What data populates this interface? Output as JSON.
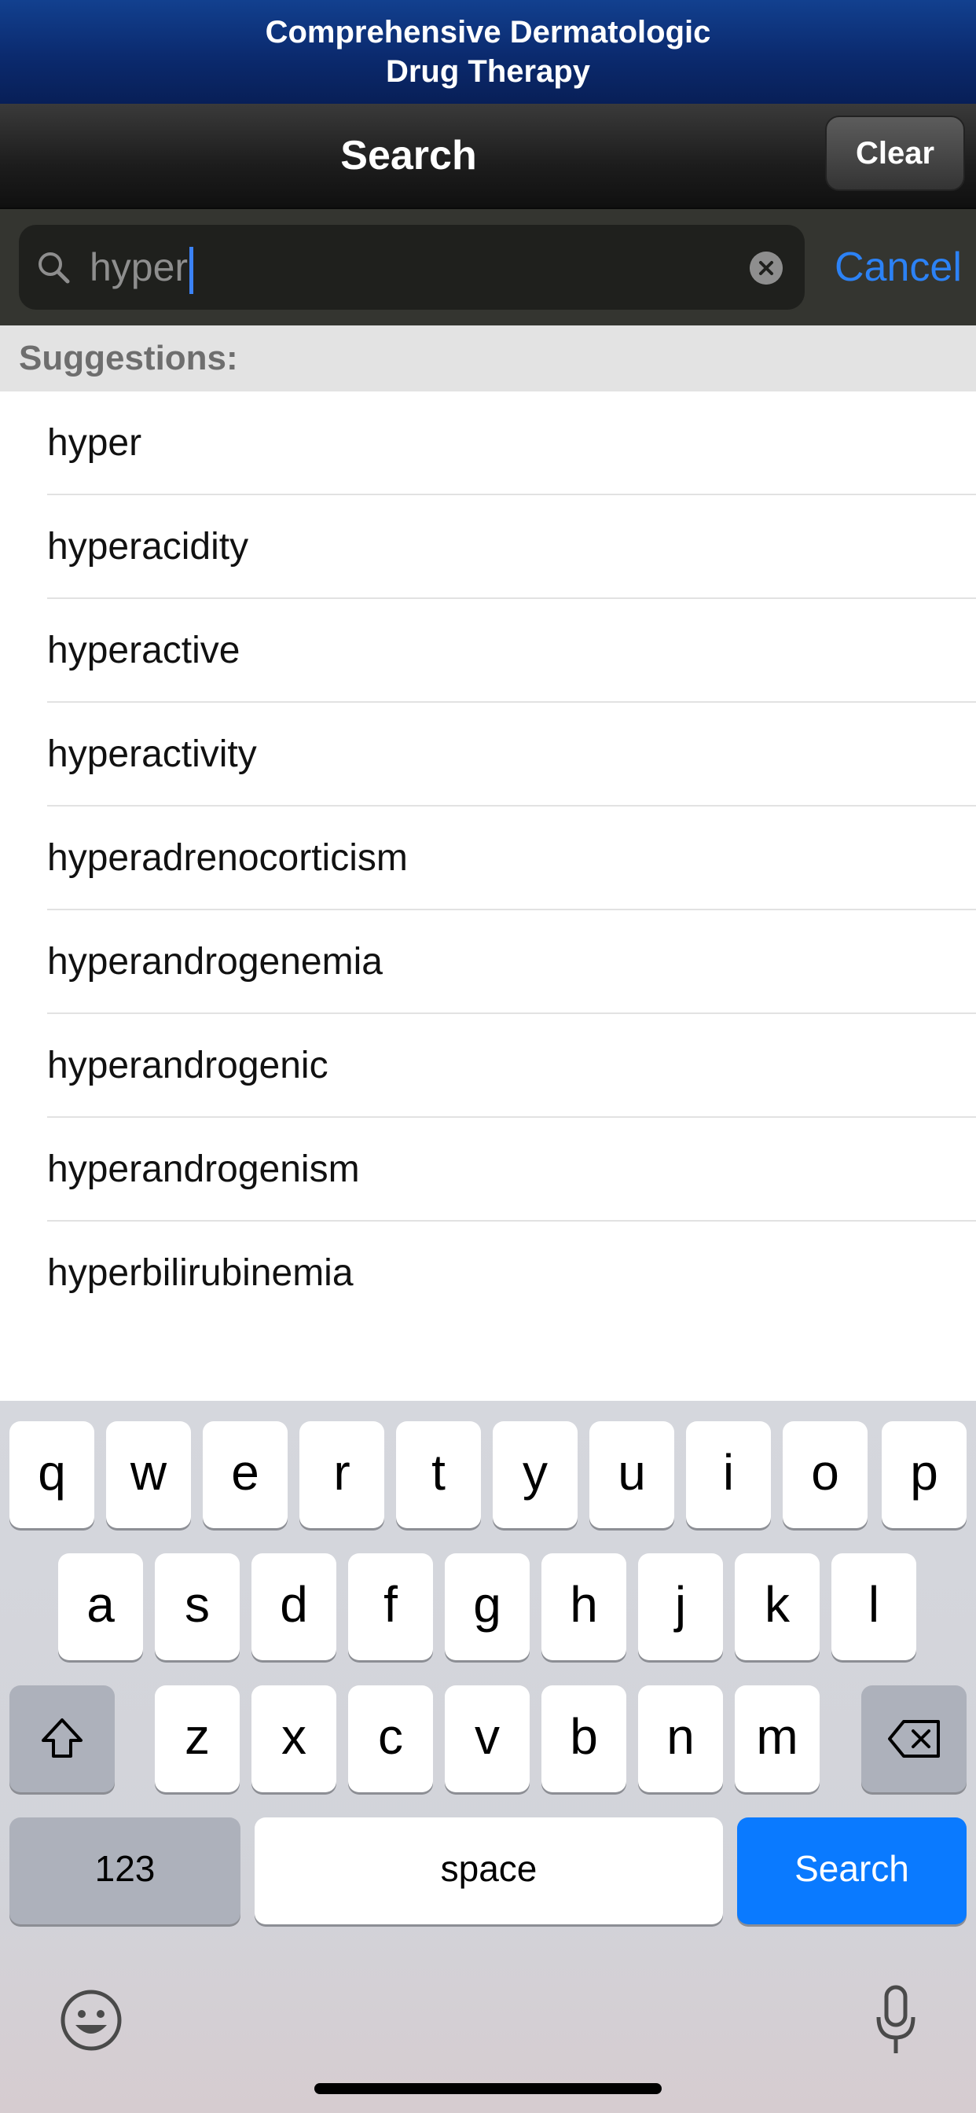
{
  "app_title_line1": "Comprehensive Dermatologic",
  "app_title_line2": "Drug Therapy",
  "nav": {
    "title": "Search",
    "clear_label": "Clear"
  },
  "search": {
    "value": "hyper",
    "cancel_label": "Cancel"
  },
  "suggestions": {
    "header": "Suggestions:",
    "items": [
      "hyper",
      "hyperacidity",
      "hyperactive",
      "hyperactivity",
      "hyperadrenocorticism",
      "hyperandrogenemia",
      "hyperandrogenic",
      "hyperandrogenism",
      "hyperbilirubinemia"
    ]
  },
  "keyboard": {
    "row1": [
      "q",
      "w",
      "e",
      "r",
      "t",
      "y",
      "u",
      "i",
      "o",
      "p"
    ],
    "row2": [
      "a",
      "s",
      "d",
      "f",
      "g",
      "h",
      "j",
      "k",
      "l"
    ],
    "row3": [
      "z",
      "x",
      "c",
      "v",
      "b",
      "n",
      "m"
    ],
    "numbers_label": "123",
    "space_label": "space",
    "search_label": "Search",
    "icons": [
      "shift-icon",
      "backspace-icon",
      "emoji-icon",
      "microphone-icon"
    ]
  },
  "colors": {
    "accent": "#2c82f5",
    "title_bar": "#0b2a6e",
    "search_key": "#0a7aff"
  }
}
